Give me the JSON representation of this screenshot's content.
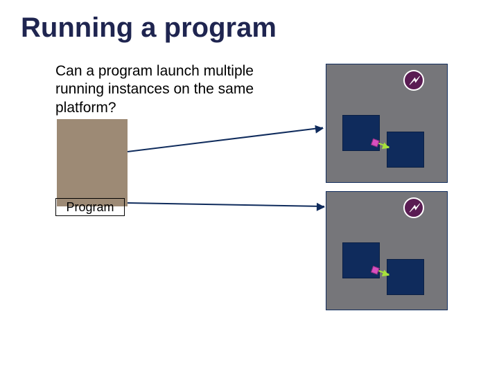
{
  "title": "Running a program",
  "question": "Can a program launch multiple running instances on the same platform?",
  "program_label": "Program",
  "icons": {
    "bolt": "⚡"
  }
}
